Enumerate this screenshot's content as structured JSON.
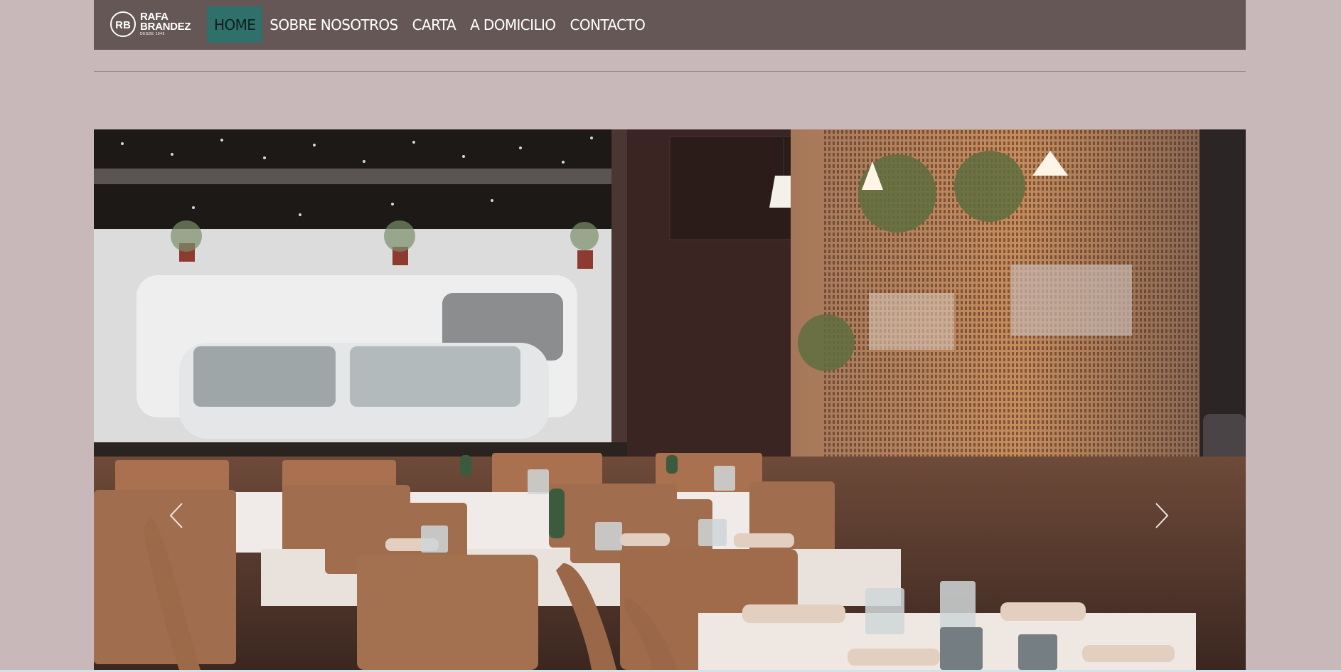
{
  "brand": {
    "name_line1": "RAFA",
    "name_line2": "BRANDEZ",
    "tagline": "DESDE 1949",
    "monogram": "RB"
  },
  "nav": {
    "items": [
      {
        "label": "HOME",
        "active": true
      },
      {
        "label": "SOBRE NOSOTROS",
        "active": false
      },
      {
        "label": "CARTA",
        "active": false
      },
      {
        "label": "A DOMICILIO",
        "active": false
      },
      {
        "label": "CONTACTO",
        "active": false
      }
    ]
  },
  "carousel": {
    "prev_icon": "chevron-left-icon",
    "next_icon": "chevron-right-icon",
    "image": "restaurant-interior-photo"
  },
  "colors": {
    "page_bg": "#c8b8b9",
    "navbar_bg": "#665757",
    "active_nav_bg": "#2f706b"
  }
}
